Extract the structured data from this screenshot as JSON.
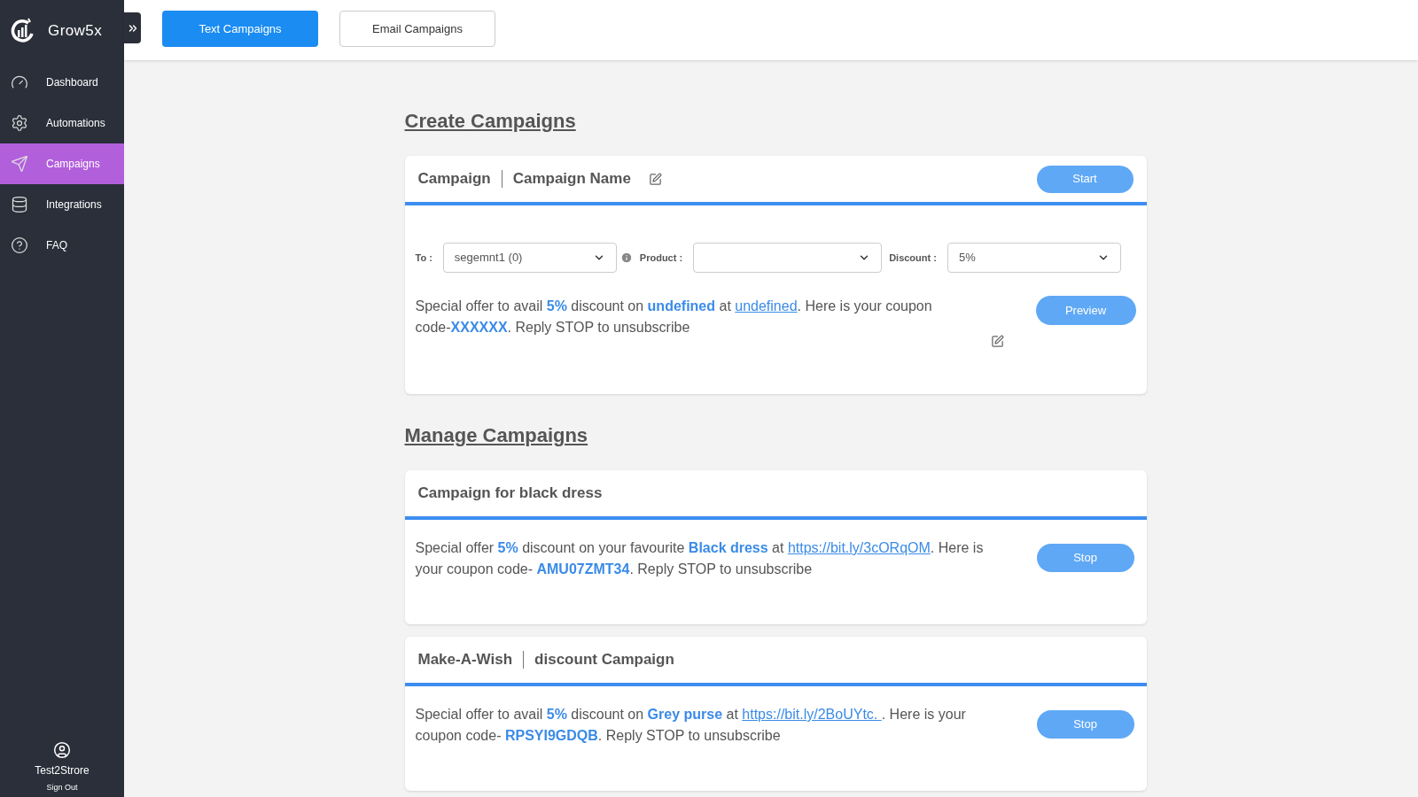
{
  "sidebar": {
    "brand": "Grow5x",
    "items": [
      {
        "label": "Dashboard",
        "kind": "gauge",
        "selected": false
      },
      {
        "label": "Automations",
        "kind": "gears",
        "selected": false
      },
      {
        "label": "Campaigns",
        "kind": "send",
        "selected": true
      },
      {
        "label": "Integrations",
        "kind": "database",
        "selected": false
      },
      {
        "label": "FAQ",
        "kind": "help",
        "selected": false
      }
    ],
    "user": {
      "name": "Test2Strore",
      "sign_out": "Sign Out"
    }
  },
  "tabs": [
    {
      "label": "Text Campaigns",
      "selected": true
    },
    {
      "label": "Email Campaigns",
      "selected": false
    }
  ],
  "create": {
    "heading": "Create Campaigns",
    "card": {
      "title_parts": [
        "Campaign",
        "Campaign Name"
      ],
      "start_button": "Start",
      "fields": [
        {
          "label": "To :",
          "value": "segemnt1 (0)",
          "info_icon": true
        },
        {
          "label": "Product :",
          "info_icon": false
        },
        {
          "label": "Discount :",
          "value": "5%",
          "info_icon": false
        }
      ],
      "message": [
        {
          "kind": "plain",
          "text": "Special offer to avail "
        },
        {
          "kind": "highlight",
          "text": "5%"
        },
        {
          "kind": "plain",
          "text": " discount on "
        },
        {
          "kind": "highlight",
          "text": "undefined"
        },
        {
          "kind": "plain",
          "text": " at "
        },
        {
          "kind": "link",
          "text": "undefined"
        },
        {
          "kind": "plain",
          "text": ". Here is your coupon code-"
        },
        {
          "kind": "highlight",
          "text": "XXXXXX"
        },
        {
          "kind": "plain",
          "text": ". Reply STOP to unsubscribe"
        }
      ],
      "preview_button": "Preview"
    }
  },
  "manage": {
    "heading": "Manage Campaigns",
    "campaigns": [
      {
        "title_parts": [
          "Campaign for black dress"
        ],
        "button": "Stop",
        "message": [
          {
            "kind": "plain",
            "text": "Special offer "
          },
          {
            "kind": "highlight",
            "text": "5%"
          },
          {
            "kind": "plain",
            "text": " discount on your favourite "
          },
          {
            "kind": "highlight",
            "text": "Black dress"
          },
          {
            "kind": "plain",
            "text": " at "
          },
          {
            "kind": "link",
            "text": "https://bit.ly/3cORqOM"
          },
          {
            "kind": "plain",
            "text": ". Here is your coupon code- "
          },
          {
            "kind": "highlight",
            "text": "AMU07ZMT34"
          },
          {
            "kind": "plain",
            "text": ". Reply STOP to unsubscribe"
          }
        ]
      },
      {
        "title_parts": [
          "Make-A-Wish",
          "discount Campaign"
        ],
        "button": "Stop",
        "message": [
          {
            "kind": "plain",
            "text": "Special offer to avail "
          },
          {
            "kind": "highlight",
            "text": "5%"
          },
          {
            "kind": "plain",
            "text": " discount on "
          },
          {
            "kind": "highlight",
            "text": "Grey purse"
          },
          {
            "kind": "plain",
            "text": " at "
          },
          {
            "kind": "link",
            "text": "https://bit.ly/2BoUYtc. "
          },
          {
            "kind": "plain",
            "text": ". Here is your coupon code- "
          },
          {
            "kind": "highlight",
            "text": "RPSYI9GDQB"
          },
          {
            "kind": "plain",
            "text": ". Reply STOP to unsubscribe"
          }
        ]
      }
    ]
  }
}
